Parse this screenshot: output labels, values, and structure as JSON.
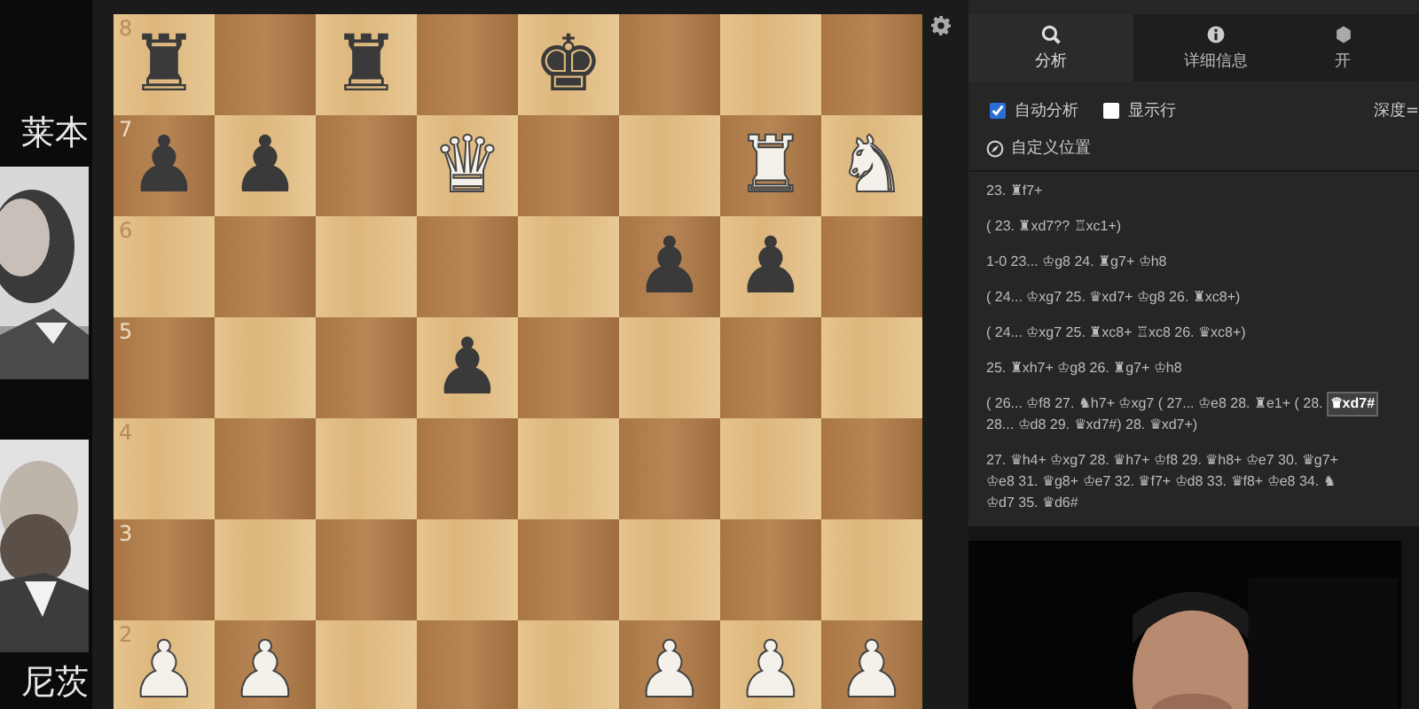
{
  "players": [
    {
      "name": "莱本"
    },
    {
      "name": "尼茨"
    }
  ],
  "board": {
    "ranks": [
      {
        "label": "8",
        "squares": [
          {
            "kind": "black",
            "glyph": "♜"
          },
          {
            "kind": "empty"
          },
          {
            "kind": "black",
            "glyph": "♜"
          },
          {
            "kind": "empty"
          },
          {
            "kind": "black",
            "glyph": "♚"
          },
          {
            "kind": "empty"
          },
          {
            "kind": "empty"
          },
          {
            "kind": "empty"
          }
        ]
      },
      {
        "label": "7",
        "squares": [
          {
            "kind": "black",
            "glyph": "♟"
          },
          {
            "kind": "black",
            "glyph": "♟"
          },
          {
            "kind": "empty"
          },
          {
            "kind": "white",
            "glyph": "♛"
          },
          {
            "kind": "empty"
          },
          {
            "kind": "empty"
          },
          {
            "kind": "white",
            "glyph": "♜"
          },
          {
            "kind": "white",
            "glyph": "♞"
          }
        ]
      },
      {
        "label": "6",
        "squares": [
          {
            "kind": "empty"
          },
          {
            "kind": "empty"
          },
          {
            "kind": "empty"
          },
          {
            "kind": "empty"
          },
          {
            "kind": "empty"
          },
          {
            "kind": "black",
            "glyph": "♟"
          },
          {
            "kind": "black",
            "glyph": "♟"
          },
          {
            "kind": "empty"
          }
        ]
      },
      {
        "label": "5",
        "squares": [
          {
            "kind": "empty"
          },
          {
            "kind": "empty"
          },
          {
            "kind": "empty"
          },
          {
            "kind": "black",
            "glyph": "♟"
          },
          {
            "kind": "empty"
          },
          {
            "kind": "empty"
          },
          {
            "kind": "empty"
          },
          {
            "kind": "empty"
          }
        ]
      },
      {
        "label": "4",
        "squares": [
          {
            "kind": "empty"
          },
          {
            "kind": "empty"
          },
          {
            "kind": "empty"
          },
          {
            "kind": "empty"
          },
          {
            "kind": "empty"
          },
          {
            "kind": "empty"
          },
          {
            "kind": "empty"
          },
          {
            "kind": "empty"
          }
        ]
      },
      {
        "label": "3",
        "squares": [
          {
            "kind": "empty"
          },
          {
            "kind": "empty"
          },
          {
            "kind": "empty"
          },
          {
            "kind": "empty"
          },
          {
            "kind": "empty"
          },
          {
            "kind": "empty"
          },
          {
            "kind": "empty"
          },
          {
            "kind": "empty"
          }
        ]
      },
      {
        "label": "2",
        "squares": [
          {
            "kind": "white",
            "glyph": "♟"
          },
          {
            "kind": "white",
            "glyph": "♟"
          },
          {
            "kind": "empty"
          },
          {
            "kind": "empty"
          },
          {
            "kind": "empty"
          },
          {
            "kind": "white",
            "glyph": "♟"
          },
          {
            "kind": "white",
            "glyph": "♟"
          },
          {
            "kind": "white",
            "glyph": "♟"
          }
        ]
      }
    ]
  },
  "tabs": [
    {
      "label": "分析",
      "selected": true
    },
    {
      "label": "详细信息",
      "selected": false
    },
    {
      "label": "开",
      "selected": false
    }
  ],
  "options": [
    {
      "label": "自动分析",
      "checked": true
    },
    {
      "label": "显示行",
      "checked": false
    }
  ],
  "depth_label": "深度=",
  "custom_position": "自定义位置",
  "moves": [
    {
      "parts": [
        {
          "text": "23. ♜f7+",
          "selected": false
        }
      ]
    },
    {
      "parts": [
        {
          "text": "( 23. ♜xd7?? ♖xc1+)",
          "selected": false
        }
      ]
    },
    {
      "parts": [
        {
          "text": "1-0 23... ♔g8 24. ♜g7+ ♔h8",
          "selected": false
        }
      ]
    },
    {
      "parts": [
        {
          "text": "( 24... ♔xg7 25. ♛xd7+ ♔g8 26. ♜xc8+)",
          "selected": false
        }
      ]
    },
    {
      "parts": [
        {
          "text": "( 24... ♔xg7 25. ♜xc8+ ♖xc8 26. ♛xc8+)",
          "selected": false
        }
      ]
    },
    {
      "parts": [
        {
          "text": "25. ♜xh7+ ♔g8 26. ♜g7+ ♔h8",
          "selected": false
        }
      ]
    },
    {
      "parts": [
        {
          "text": "( 26... ♔f8 27. ♞h7+ ♔xg7 ( 27... ♔e8 28. ♜e1+ ( 28.",
          "selected": false
        },
        {
          "text": "♛xd7#",
          "selected": true
        },
        {
          "text": "28... ♔d8 29. ♛xd7#) 28. ♛xd7+)",
          "selected": false
        }
      ]
    },
    {
      "parts": [
        {
          "text": "27. ♛h4+ ♔xg7 28. ♛h7+ ♔f8 29. ♛h8+ ♔e7 30. ♛g7+",
          "selected": false
        },
        {
          "text": "♔e8 31. ♛g8+ ♔e7 32. ♛f7+ ♔d8 33. ♛f8+ ♔e8 34. ♞",
          "selected": false
        },
        {
          "text": "♔d7 35. ♛d6#",
          "selected": false
        }
      ]
    }
  ]
}
